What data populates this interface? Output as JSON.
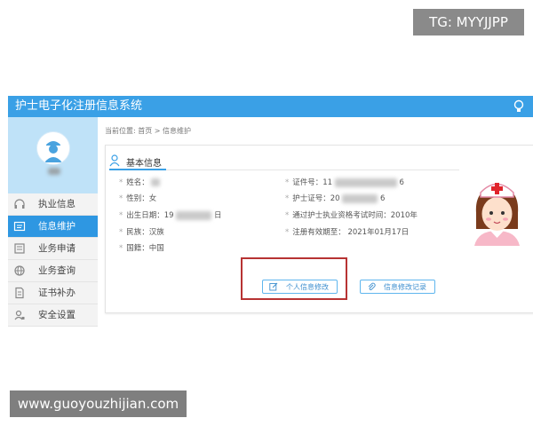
{
  "watermarks": {
    "tg": "TG: MYYJJPP",
    "url": "www.guoyouzhijian.com"
  },
  "app": {
    "title": "护士电子化注册信息系统",
    "accent_color": "#3aa0e6"
  },
  "sidebar": {
    "items": [
      {
        "label": "执业信息",
        "icon": "headset-icon",
        "active": false
      },
      {
        "label": "信息维护",
        "icon": "id-card-icon",
        "active": true
      },
      {
        "label": "业务申请",
        "icon": "form-icon",
        "active": false
      },
      {
        "label": "业务查询",
        "icon": "globe-icon",
        "active": false
      },
      {
        "label": "证书补办",
        "icon": "document-icon",
        "active": false
      },
      {
        "label": "安全设置",
        "icon": "user-lock-icon",
        "active": false
      }
    ]
  },
  "breadcrumb": {
    "prefix": "当前位置:",
    "home": "首页",
    "separator": ">",
    "current": "信息维护"
  },
  "basic_info": {
    "title": "基本信息",
    "name_label": "姓名：",
    "gender": "性别：女",
    "birth_label": "出生日期：19",
    "birth_suffix": "日",
    "ethnicity": "民族：汉族",
    "nationality": "国籍：中国",
    "id_label": "证件号：11",
    "id_suffix": "6",
    "nurse_cert_label": "护士证号：20",
    "nurse_cert_suffix": "6",
    "exam_pass": "通过护士执业资格考试时间：2010年",
    "valid_until": "注册有效期至：  2021年01月17日"
  },
  "buttons": {
    "edit_label": "个人信息修改",
    "log_label": "信息修改记录"
  }
}
